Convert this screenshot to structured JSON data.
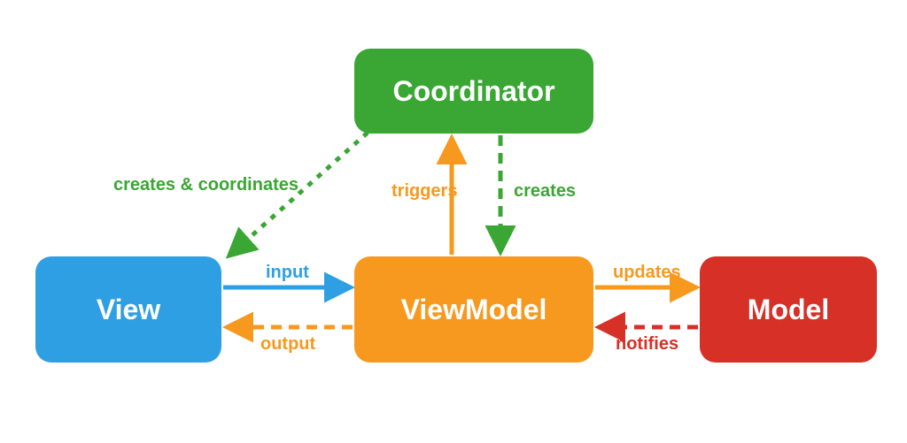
{
  "boxes": {
    "coordinator": "Coordinator",
    "view": "View",
    "viewmodel": "ViewModel",
    "model": "Model"
  },
  "labels": {
    "creates_coordinates": "creates & coordinates",
    "triggers": "triggers",
    "creates": "creates",
    "input": "input",
    "output": "output",
    "updates": "updates",
    "notifies": "notifies"
  },
  "colors": {
    "green": "#3AA633",
    "blue": "#2F9FE4",
    "orange": "#F6991E",
    "red": "#D73027"
  }
}
